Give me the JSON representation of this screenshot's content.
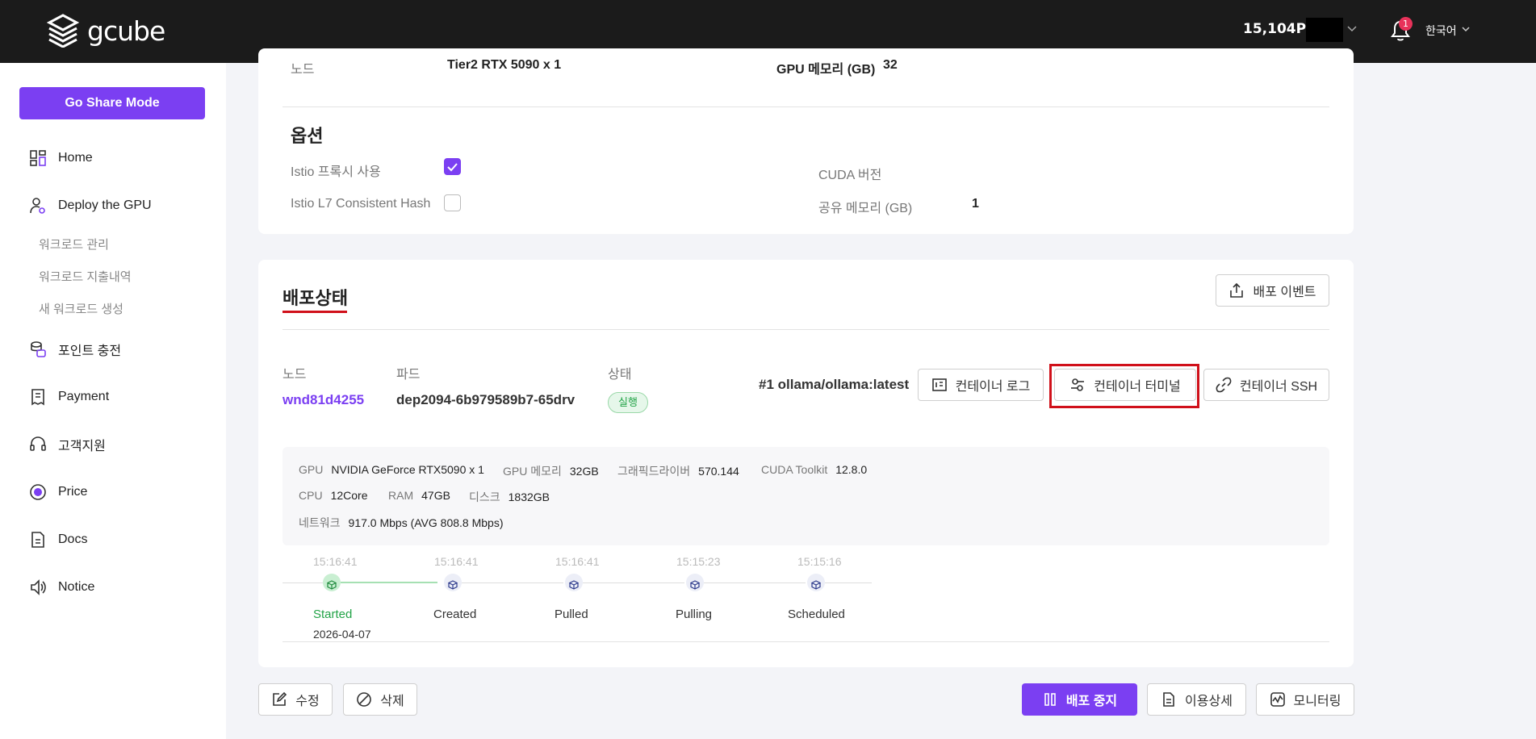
{
  "header": {
    "logo_text": "gcube",
    "points": "15,104P",
    "notification_count": "1",
    "language": "한국어"
  },
  "sidebar": {
    "share_button": "Go Share Mode",
    "items": [
      {
        "label": "Home",
        "icon": "dashboard-icon"
      },
      {
        "label": "Deploy the GPU",
        "icon": "user-gear-icon"
      },
      {
        "label": "포인트 충전",
        "icon": "coins-icon"
      },
      {
        "label": "Payment",
        "icon": "receipt-icon"
      },
      {
        "label": "고객지원",
        "icon": "headset-icon"
      },
      {
        "label": "Price",
        "icon": "price-icon"
      },
      {
        "label": "Docs",
        "icon": "document-icon"
      },
      {
        "label": "Notice",
        "icon": "speaker-icon"
      }
    ],
    "sub_items": [
      "워크로드 관리",
      "워크로드 지출내역",
      "새 워크로드 생성"
    ]
  },
  "top_card": {
    "node_label": "노드",
    "node_value": "Tier2 RTX 5090 x 1",
    "gpu_memory_label": "GPU 메모리 (GB)",
    "gpu_memory_value": "32",
    "options_title": "옵션",
    "istio_proxy_label": "Istio 프록시 사용",
    "istio_proxy_checked": true,
    "istio_l7_label": "Istio L7 Consistent Hash",
    "istio_l7_checked": false,
    "cuda_label": "CUDA 버전",
    "cuda_value": "",
    "shared_mem_label": "공유 메모리 (GB)",
    "shared_mem_value": "1"
  },
  "deploy_status": {
    "title": "배포상태",
    "events_button": "배포 이벤트",
    "col_node": "노드",
    "col_pod": "파드",
    "col_status": "상태",
    "node_value": "wnd81d4255",
    "pod_value": "dep2094-6b979589b7-65drv",
    "status_value": "실행",
    "image": "#1 ollama/ollama:latest",
    "log_button": "컨테이너 로그",
    "terminal_button": "컨테이너 터미널",
    "ssh_button": "컨테이너 SSH",
    "specs": {
      "gpu_k": "GPU",
      "gpu_v": "NVIDIA GeForce RTX5090 x 1",
      "gpumem_k": "GPU 메모리",
      "gpumem_v": "32GB",
      "driver_k": "그래픽드라이버",
      "driver_v": "570.144",
      "cuda_k": "CUDA Toolkit",
      "cuda_v": "12.8.0",
      "cpu_k": "CPU",
      "cpu_v": "12Core",
      "ram_k": "RAM",
      "ram_v": "47GB",
      "disk_k": "디스크",
      "disk_v": "1832GB",
      "net_k": "네트워크",
      "net_v": "917.0 Mbps (AVG 808.8 Mbps)"
    },
    "timeline": [
      {
        "time": "15:16:41",
        "label": "Started",
        "date": "2026-04-07",
        "done": true
      },
      {
        "time": "15:16:41",
        "label": "Created",
        "done": false
      },
      {
        "time": "15:16:41",
        "label": "Pulled",
        "done": false
      },
      {
        "time": "15:15:23",
        "label": "Pulling",
        "done": false
      },
      {
        "time": "15:15:16",
        "label": "Scheduled",
        "done": false
      }
    ]
  },
  "footer": {
    "edit_button": "수정",
    "delete_button": "삭제",
    "stop_button": "배포 중지",
    "usage_button": "이용상세",
    "monitor_button": "모니터링"
  },
  "colors": {
    "accent": "#7b3ff2",
    "topbar": "#1b1b1b",
    "success": "#22a347",
    "highlight": "#d0101a"
  }
}
